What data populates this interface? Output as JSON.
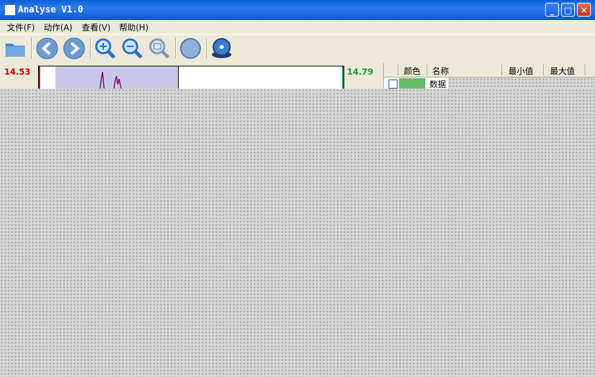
{
  "window": {
    "title": "Analyse V1.0"
  },
  "menu": {
    "items": [
      {
        "label": "文件(F)"
      },
      {
        "label": "动作(A)"
      },
      {
        "label": "查看(V)"
      },
      {
        "label": "帮助(H)"
      }
    ]
  },
  "toolbar": {
    "tools": [
      "folder-open-icon",
      "back-arrow-icon",
      "forward-arrow-icon",
      "zoom-in-icon",
      "zoom-out-icon",
      "zoom-reset-icon",
      "circle-icon",
      "disk-icon"
    ]
  },
  "plot": {
    "left_value": "14.53",
    "right_value": "14.79",
    "selection_color": "#c8c8e6",
    "trace_color": "#800080"
  },
  "grid": {
    "columns": [
      "颜色",
      "名称",
      "最小值",
      "最大值"
    ],
    "rows": [
      {
        "checked": false,
        "color": "#66bb66",
        "name": "数据"
      }
    ]
  }
}
